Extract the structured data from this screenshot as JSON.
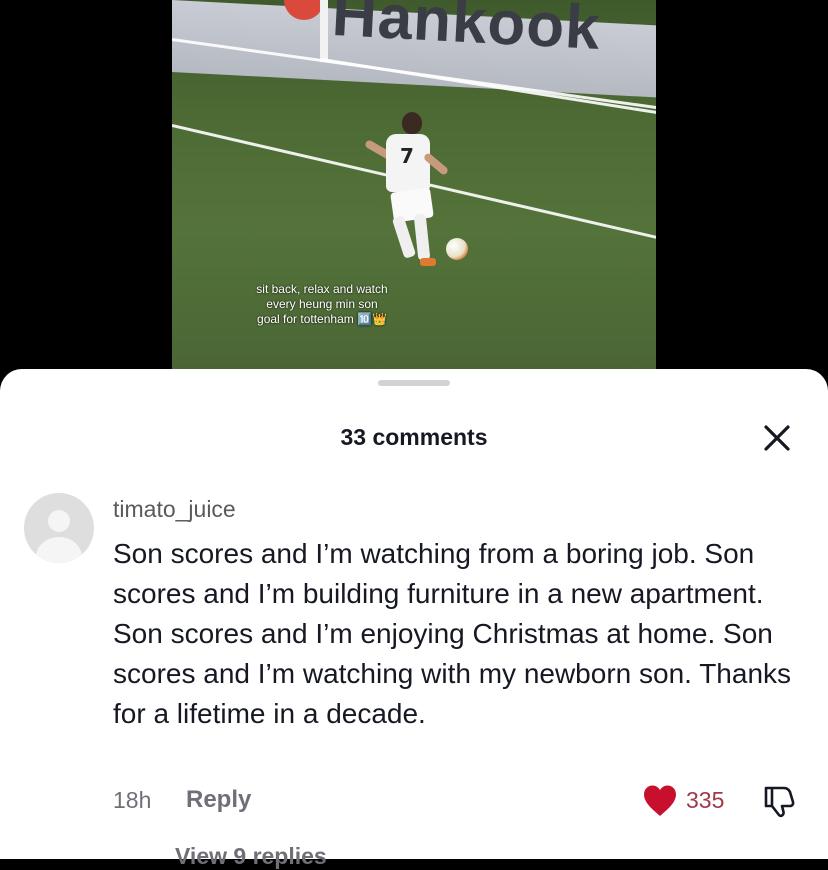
{
  "video": {
    "banner_text": "Hankook",
    "jersey_number": "7",
    "caption_lines": [
      "sit back, relax and watch",
      "every heung min son",
      "goal for tottenham 🔟👑"
    ]
  },
  "comments_panel": {
    "title": "33 comments",
    "close_icon": "close-icon"
  },
  "comment": {
    "username": "timato_juice",
    "text": "Son scores and I’m watching from a boring job. Son scores and I’m building furniture in a new apartment. Son scores and I’m enjoying Christmas at home. Son scores and I’m watching with my newborn son. Thanks for a lifetime in a decade.",
    "time": "18h",
    "reply_label": "Reply",
    "like_count": "335",
    "liked": true,
    "like_color": "#c8102e",
    "view_replies": "View 9 replies"
  }
}
